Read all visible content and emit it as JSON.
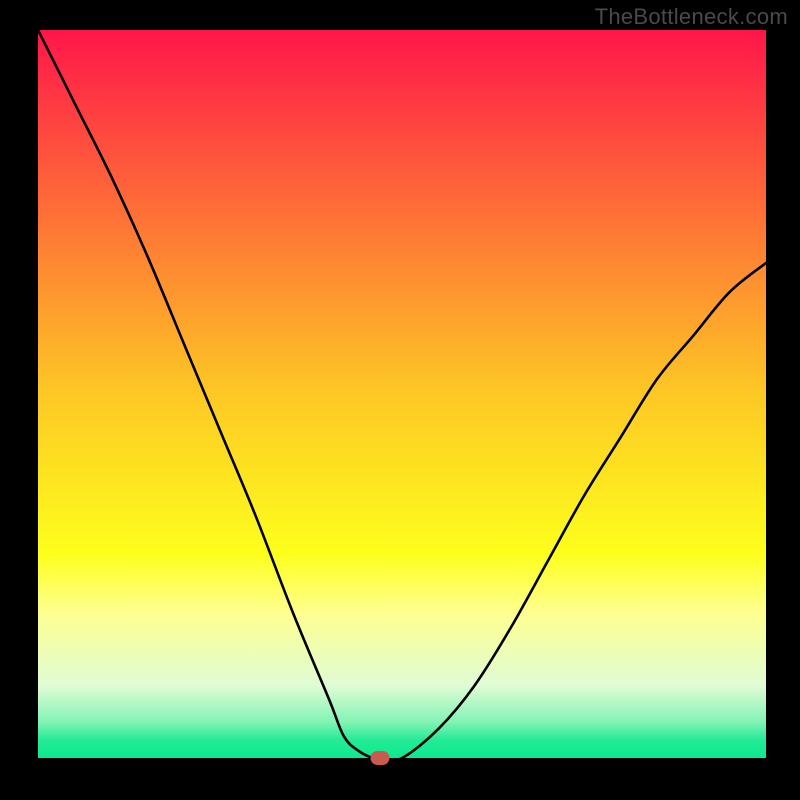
{
  "watermark": "TheBottleneck.com",
  "chart_data": {
    "type": "line",
    "title": "",
    "xlabel": "",
    "ylabel": "",
    "xlim": [
      0,
      100
    ],
    "ylim": [
      0,
      100
    ],
    "grid": false,
    "series": [
      {
        "name": "curve",
        "x": [
          0,
          5,
          10,
          15,
          20,
          25,
          30,
          35,
          40,
          42,
          44,
          46,
          47,
          50,
          55,
          60,
          65,
          70,
          75,
          80,
          85,
          90,
          95,
          100
        ],
        "y": [
          100,
          90,
          80,
          69,
          57,
          45,
          33,
          20,
          8,
          3,
          1,
          0,
          0,
          0,
          4,
          10,
          18,
          27,
          36,
          44,
          52,
          58,
          64,
          68
        ]
      }
    ],
    "marker": {
      "x": 47,
      "y": 0,
      "color": "#c85a4e"
    },
    "gradient_stops": [
      {
        "offset": 0.0,
        "color": "#ff164a"
      },
      {
        "offset": 0.25,
        "color": "#fe6f37"
      },
      {
        "offset": 0.5,
        "color": "#fdc824"
      },
      {
        "offset": 0.72,
        "color": "#fdff1c"
      },
      {
        "offset": 0.8,
        "color": "#feff8f"
      },
      {
        "offset": 0.9,
        "color": "#e0fcd5"
      },
      {
        "offset": 0.95,
        "color": "#84f3b6"
      },
      {
        "offset": 0.975,
        "color": "#25eb97"
      },
      {
        "offset": 1.0,
        "color": "#0be98e"
      }
    ]
  }
}
